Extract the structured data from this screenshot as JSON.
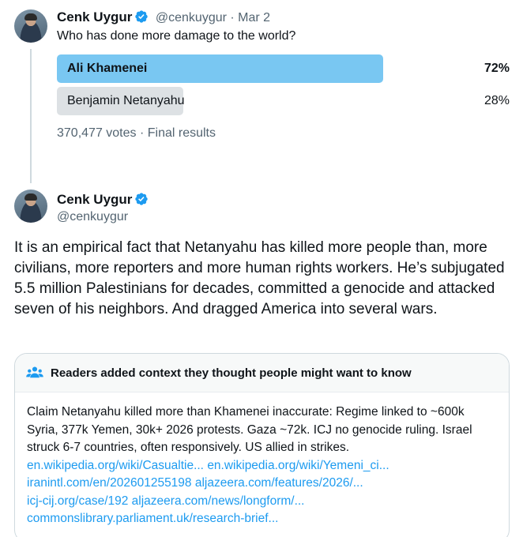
{
  "poll_tweet": {
    "author_name": "Cenk Uygur",
    "handle_date": "@cenkuygur · Mar 2",
    "question": "Who has done more damage to the world?",
    "options": [
      {
        "label": "Ali Khamenei",
        "percent_label": "72%",
        "percent": 72
      },
      {
        "label": "Benjamin Netanyahu",
        "percent_label": "28%",
        "percent": 28
      }
    ],
    "votes_text": "370,477 votes · Final results"
  },
  "reply_tweet": {
    "author_name": "Cenk Uygur",
    "handle": "@cenkuygur",
    "body": "It is an empirical fact that Netanyahu has killed more people than, more civilians, more reporters and more human rights workers. He’s subjugated 5.5 million Palestinians for decades, committed a genocide and attacked seven of his neighbors. And dragged America into several wars."
  },
  "community_note": {
    "heading": "Readers added context they thought people might want to know",
    "text": "Claim Netanyahu killed more than Khamenei inaccurate: Regime linked to ~600k Syria, 377k Yemen, 30k+ 2026 protests. Gaza ~72k. ICJ no genocide ruling. Israel struck 6-7 countries, often responsively. US allied in strikes.",
    "links": [
      "en.wikipedia.org/wiki/Casualtie...",
      "en.wikipedia.org/wiki/Yemeni_ci...",
      "iranintl.com/en/202601255198",
      "aljazeera.com/features/2026/...",
      "icj-cij.org/case/192",
      "aljazeera.com/news/longform/...",
      "commonslibrary.parliament.uk/research-brief..."
    ]
  },
  "colors": {
    "verified_blue": "#1d9bf0",
    "winner_bar": "#79c7f2",
    "loser_bar": "#dde1e4",
    "muted_text": "#536471"
  },
  "icons": [
    "verified-badge-icon",
    "people-icon"
  ]
}
